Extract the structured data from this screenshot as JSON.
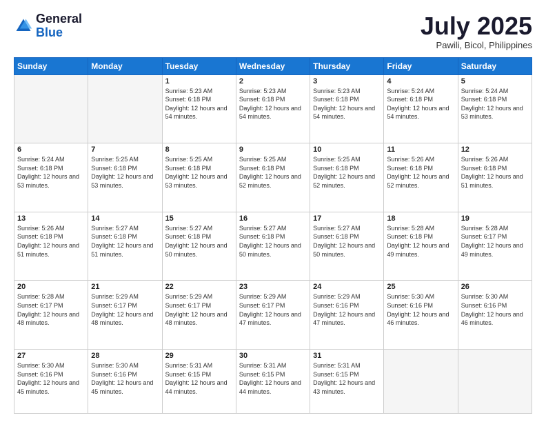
{
  "header": {
    "logo_general": "General",
    "logo_blue": "Blue",
    "month_title": "July 2025",
    "location": "Pawili, Bicol, Philippines"
  },
  "days_of_week": [
    "Sunday",
    "Monday",
    "Tuesday",
    "Wednesday",
    "Thursday",
    "Friday",
    "Saturday"
  ],
  "weeks": [
    [
      {
        "num": "",
        "info": ""
      },
      {
        "num": "",
        "info": ""
      },
      {
        "num": "1",
        "info": "Sunrise: 5:23 AM\nSunset: 6:18 PM\nDaylight: 12 hours and 54 minutes."
      },
      {
        "num": "2",
        "info": "Sunrise: 5:23 AM\nSunset: 6:18 PM\nDaylight: 12 hours and 54 minutes."
      },
      {
        "num": "3",
        "info": "Sunrise: 5:23 AM\nSunset: 6:18 PM\nDaylight: 12 hours and 54 minutes."
      },
      {
        "num": "4",
        "info": "Sunrise: 5:24 AM\nSunset: 6:18 PM\nDaylight: 12 hours and 54 minutes."
      },
      {
        "num": "5",
        "info": "Sunrise: 5:24 AM\nSunset: 6:18 PM\nDaylight: 12 hours and 53 minutes."
      }
    ],
    [
      {
        "num": "6",
        "info": "Sunrise: 5:24 AM\nSunset: 6:18 PM\nDaylight: 12 hours and 53 minutes."
      },
      {
        "num": "7",
        "info": "Sunrise: 5:25 AM\nSunset: 6:18 PM\nDaylight: 12 hours and 53 minutes."
      },
      {
        "num": "8",
        "info": "Sunrise: 5:25 AM\nSunset: 6:18 PM\nDaylight: 12 hours and 53 minutes."
      },
      {
        "num": "9",
        "info": "Sunrise: 5:25 AM\nSunset: 6:18 PM\nDaylight: 12 hours and 52 minutes."
      },
      {
        "num": "10",
        "info": "Sunrise: 5:25 AM\nSunset: 6:18 PM\nDaylight: 12 hours and 52 minutes."
      },
      {
        "num": "11",
        "info": "Sunrise: 5:26 AM\nSunset: 6:18 PM\nDaylight: 12 hours and 52 minutes."
      },
      {
        "num": "12",
        "info": "Sunrise: 5:26 AM\nSunset: 6:18 PM\nDaylight: 12 hours and 51 minutes."
      }
    ],
    [
      {
        "num": "13",
        "info": "Sunrise: 5:26 AM\nSunset: 6:18 PM\nDaylight: 12 hours and 51 minutes."
      },
      {
        "num": "14",
        "info": "Sunrise: 5:27 AM\nSunset: 6:18 PM\nDaylight: 12 hours and 51 minutes."
      },
      {
        "num": "15",
        "info": "Sunrise: 5:27 AM\nSunset: 6:18 PM\nDaylight: 12 hours and 50 minutes."
      },
      {
        "num": "16",
        "info": "Sunrise: 5:27 AM\nSunset: 6:18 PM\nDaylight: 12 hours and 50 minutes."
      },
      {
        "num": "17",
        "info": "Sunrise: 5:27 AM\nSunset: 6:18 PM\nDaylight: 12 hours and 50 minutes."
      },
      {
        "num": "18",
        "info": "Sunrise: 5:28 AM\nSunset: 6:18 PM\nDaylight: 12 hours and 49 minutes."
      },
      {
        "num": "19",
        "info": "Sunrise: 5:28 AM\nSunset: 6:17 PM\nDaylight: 12 hours and 49 minutes."
      }
    ],
    [
      {
        "num": "20",
        "info": "Sunrise: 5:28 AM\nSunset: 6:17 PM\nDaylight: 12 hours and 48 minutes."
      },
      {
        "num": "21",
        "info": "Sunrise: 5:29 AM\nSunset: 6:17 PM\nDaylight: 12 hours and 48 minutes."
      },
      {
        "num": "22",
        "info": "Sunrise: 5:29 AM\nSunset: 6:17 PM\nDaylight: 12 hours and 48 minutes."
      },
      {
        "num": "23",
        "info": "Sunrise: 5:29 AM\nSunset: 6:17 PM\nDaylight: 12 hours and 47 minutes."
      },
      {
        "num": "24",
        "info": "Sunrise: 5:29 AM\nSunset: 6:16 PM\nDaylight: 12 hours and 47 minutes."
      },
      {
        "num": "25",
        "info": "Sunrise: 5:30 AM\nSunset: 6:16 PM\nDaylight: 12 hours and 46 minutes."
      },
      {
        "num": "26",
        "info": "Sunrise: 5:30 AM\nSunset: 6:16 PM\nDaylight: 12 hours and 46 minutes."
      }
    ],
    [
      {
        "num": "27",
        "info": "Sunrise: 5:30 AM\nSunset: 6:16 PM\nDaylight: 12 hours and 45 minutes."
      },
      {
        "num": "28",
        "info": "Sunrise: 5:30 AM\nSunset: 6:16 PM\nDaylight: 12 hours and 45 minutes."
      },
      {
        "num": "29",
        "info": "Sunrise: 5:31 AM\nSunset: 6:15 PM\nDaylight: 12 hours and 44 minutes."
      },
      {
        "num": "30",
        "info": "Sunrise: 5:31 AM\nSunset: 6:15 PM\nDaylight: 12 hours and 44 minutes."
      },
      {
        "num": "31",
        "info": "Sunrise: 5:31 AM\nSunset: 6:15 PM\nDaylight: 12 hours and 43 minutes."
      },
      {
        "num": "",
        "info": ""
      },
      {
        "num": "",
        "info": ""
      }
    ]
  ]
}
